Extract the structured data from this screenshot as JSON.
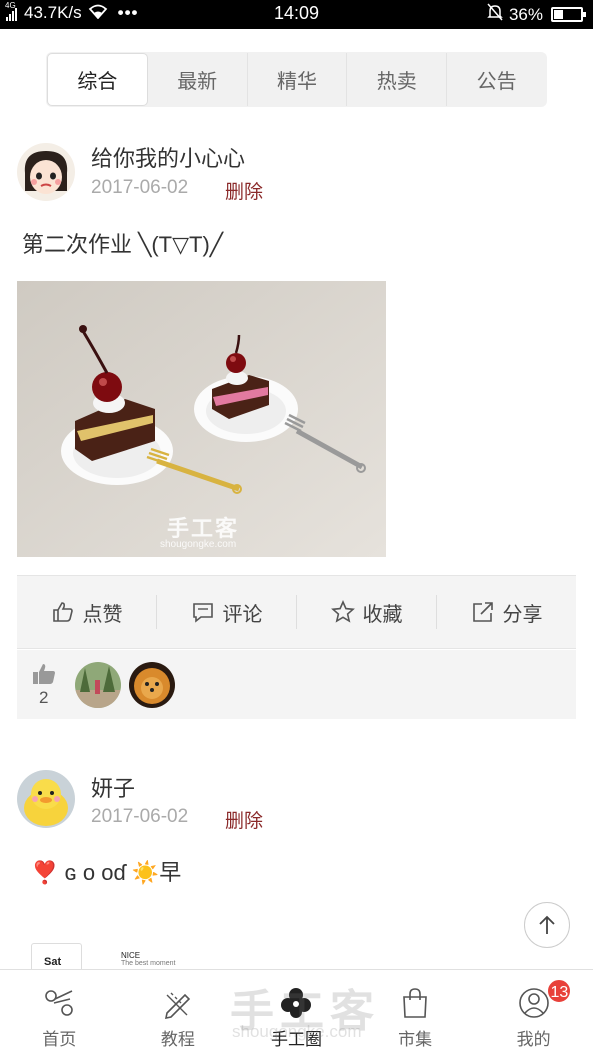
{
  "status": {
    "network": "4G",
    "speed": "43.7K/s",
    "time": "14:09",
    "battery": "36%",
    "battery_level": 0.36,
    "dots": "•••"
  },
  "tabs": [
    {
      "label": "综合",
      "active": true
    },
    {
      "label": "最新",
      "active": false
    },
    {
      "label": "精华",
      "active": false
    },
    {
      "label": "热卖",
      "active": false
    },
    {
      "label": "公告",
      "active": false
    }
  ],
  "posts": [
    {
      "username": "给你我的小心心",
      "date": "2017-06-02",
      "delete_label": "删除",
      "content": "第二次作业 ╲(T▽T)╱",
      "photo_watermark": "手工客",
      "photo_watermark_url": "shougongke.com",
      "actions": [
        "点赞",
        "评论",
        "收藏",
        "分享"
      ],
      "like_count": "2"
    },
    {
      "username": "妍子",
      "date": "2017-06-02",
      "delete_label": "删除",
      "content": "❣️ ɢ ο οɗ ☀️早"
    }
  ],
  "peek": {
    "card1": "Sat",
    "card2_title": "NICE",
    "card2_sub": "The best moment"
  },
  "nav": {
    "items": [
      {
        "label": "首页",
        "icon": "scissors-icon"
      },
      {
        "label": "教程",
        "icon": "pencil-ruler-icon"
      },
      {
        "label": "手工圈",
        "icon": "flower-icon",
        "active": true
      },
      {
        "label": "市集",
        "icon": "shopping-bag-icon"
      },
      {
        "label": "我的",
        "icon": "user-icon",
        "badge": "13"
      }
    ],
    "watermark": "手工客",
    "watermark_url": "shougongke.com"
  },
  "colors": {
    "delete": "#8b2a2a",
    "badge": "#e8413a",
    "tab_bg": "#f1f1f1"
  }
}
